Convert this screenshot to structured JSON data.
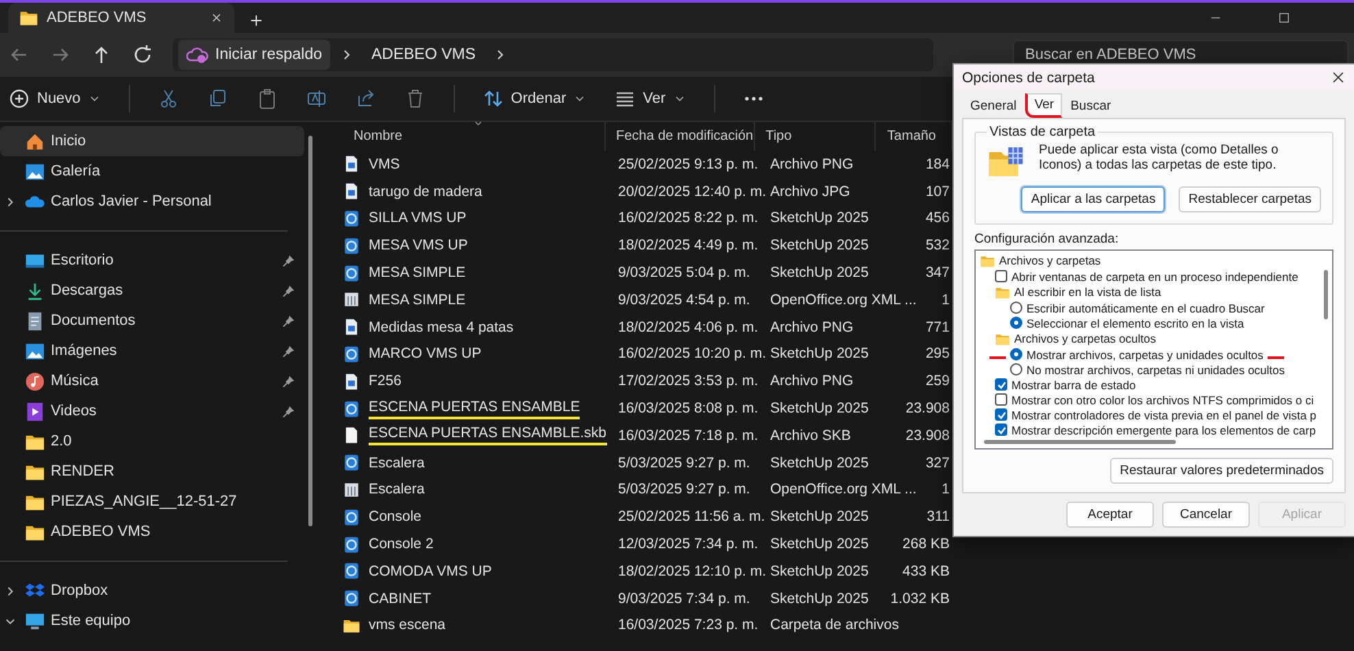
{
  "window": {
    "tab_title": "ADEBEO VMS"
  },
  "address": {
    "crumbs": [
      "Iniciar respaldo",
      "ADEBEO VMS"
    ]
  },
  "search": {
    "placeholder": "Buscar en ADEBEO VMS"
  },
  "toolbar": {
    "new_label": "Nuevo",
    "sort_label": "Ordenar",
    "view_label": "Ver"
  },
  "sidebar": {
    "sections": [
      {
        "items": [
          {
            "label": "Inicio",
            "kind": "home",
            "selected": true,
            "pinned": false
          },
          {
            "label": "Galería",
            "kind": "gallery",
            "selected": false,
            "pinned": false
          },
          {
            "label": "Carlos Javier - Personal",
            "kind": "cloud",
            "selected": false,
            "pinned": false,
            "expanded": false
          }
        ]
      },
      {
        "items": [
          {
            "label": "Escritorio",
            "kind": "desktop",
            "selected": false,
            "pinned": true
          },
          {
            "label": "Descargas",
            "kind": "download",
            "selected": false,
            "pinned": true
          },
          {
            "label": "Documentos",
            "kind": "document",
            "selected": false,
            "pinned": true
          },
          {
            "label": "Imágenes",
            "kind": "gallery",
            "selected": false,
            "pinned": true
          },
          {
            "label": "Música",
            "kind": "music",
            "selected": false,
            "pinned": true
          },
          {
            "label": "Videos",
            "kind": "video",
            "selected": false,
            "pinned": true
          },
          {
            "label": "2.0",
            "kind": "folder",
            "selected": false,
            "pinned": false
          },
          {
            "label": "RENDER",
            "kind": "folder",
            "selected": false,
            "pinned": false
          },
          {
            "label": "PIEZAS_ANGIE__12-51-27",
            "kind": "folder",
            "selected": false,
            "pinned": false
          },
          {
            "label": "ADEBEO VMS",
            "kind": "folder",
            "selected": false,
            "pinned": false
          }
        ]
      },
      {
        "items": [
          {
            "label": "Dropbox",
            "kind": "dropbox",
            "selected": false,
            "pinned": false,
            "expanded": false
          },
          {
            "label": "Este equipo",
            "kind": "computer",
            "selected": false,
            "pinned": false,
            "expanded": true
          }
        ]
      }
    ]
  },
  "file_list": {
    "columns": [
      "Nombre",
      "Fecha de modificación",
      "Tipo",
      "Tamaño"
    ],
    "rows": [
      {
        "name": "VMS",
        "date": "25/02/2025 9:13 p. m.",
        "type": "Archivo PNG",
        "size": "184",
        "kind": "image",
        "underlined": false
      },
      {
        "name": "tarugo de madera",
        "date": "20/02/2025 12:40 p. m.",
        "type": "Archivo JPG",
        "size": "107",
        "kind": "image",
        "underlined": false
      },
      {
        "name": "SILLA VMS UP",
        "date": "16/02/2025 8:22 p. m.",
        "type": "SketchUp 2025",
        "size": "456",
        "kind": "model",
        "underlined": false
      },
      {
        "name": "MESA VMS UP",
        "date": "18/02/2025 4:49 p. m.",
        "type": "SketchUp 2025",
        "size": "532",
        "kind": "model",
        "underlined": false
      },
      {
        "name": "MESA SIMPLE",
        "date": "9/03/2025 5:04 p. m.",
        "type": "SketchUp 2025",
        "size": "347",
        "kind": "model",
        "underlined": false
      },
      {
        "name": "MESA SIMPLE",
        "date": "9/03/2025 4:54 p. m.",
        "type": "OpenOffice.org XML ...",
        "size": "1",
        "kind": "sheet",
        "underlined": false
      },
      {
        "name": "Medidas mesa 4 patas",
        "date": "18/02/2025 4:06 p. m.",
        "type": "Archivo PNG",
        "size": "771",
        "kind": "image",
        "underlined": false
      },
      {
        "name": "MARCO VMS UP",
        "date": "16/02/2025 10:20 p. m.",
        "type": "SketchUp 2025",
        "size": "295",
        "kind": "model",
        "underlined": false
      },
      {
        "name": "F256",
        "date": "17/02/2025 3:53 p. m.",
        "type": "Archivo PNG",
        "size": "259",
        "kind": "image",
        "underlined": false
      },
      {
        "name": "ESCENA PUERTAS ENSAMBLE",
        "date": "16/03/2025 8:08 p. m.",
        "type": "SketchUp 2025",
        "size": "23.908",
        "kind": "model",
        "underlined": true
      },
      {
        "name": "ESCENA PUERTAS ENSAMBLE.skb",
        "date": "16/03/2025 7:18 p. m.",
        "type": "Archivo SKB",
        "size": "23.908",
        "kind": "blank",
        "underlined": true
      },
      {
        "name": "Escalera",
        "date": "5/03/2025 9:27 p. m.",
        "type": "SketchUp 2025",
        "size": "327",
        "kind": "model",
        "underlined": false
      },
      {
        "name": "Escalera",
        "date": "5/03/2025 9:27 p. m.",
        "type": "OpenOffice.org XML ...",
        "size": "1",
        "kind": "sheet",
        "underlined": false
      },
      {
        "name": "Console",
        "date": "25/02/2025 11:56 a. m.",
        "type": "SketchUp 2025",
        "size": "311",
        "kind": "model",
        "underlined": false
      },
      {
        "name": "Console 2",
        "date": "12/03/2025 7:34 p. m.",
        "type": "SketchUp 2025",
        "size": "268 KB",
        "kind": "model",
        "underlined": false
      },
      {
        "name": "COMODA VMS UP",
        "date": "18/02/2025 12:10 p. m.",
        "type": "SketchUp 2025",
        "size": "433 KB",
        "kind": "model",
        "underlined": false
      },
      {
        "name": "CABINET",
        "date": "9/03/2025 7:34 p. m.",
        "type": "SketchUp 2025",
        "size": "1.032 KB",
        "kind": "model",
        "underlined": false
      },
      {
        "name": "vms escena",
        "date": "16/03/2025 7:23 p. m.",
        "type": "Carpeta de archivos",
        "kind": "folder",
        "underlined": false
      }
    ]
  },
  "dialog": {
    "title": "Opciones de carpeta",
    "tabs": [
      {
        "label": "General",
        "selected": false,
        "annotated": false
      },
      {
        "label": "Ver",
        "selected": true,
        "annotated": true
      },
      {
        "label": "Buscar",
        "selected": false,
        "annotated": false
      }
    ],
    "folder_views": {
      "title": "Vistas de carpeta",
      "description": "Puede aplicar esta vista (como Detalles o Iconos) a todas las carpetas de este tipo.",
      "buttons": [
        {
          "label": "Aplicar a las carpetas",
          "focused": true
        },
        {
          "label": "Restablecer carpetas",
          "focused": false
        }
      ]
    },
    "advanced": {
      "label": "Configuración avanzada:",
      "items": [
        {
          "kind": "folder",
          "label": "Archivos y carpetas",
          "children": [
            {
              "kind": "checkbox",
              "label": "Abrir ventanas de carpeta  en un proceso independiente",
              "checked": false
            },
            {
              "kind": "folder",
              "label": "Al escribir en la vista de lista",
              "children": [
                {
                  "kind": "radio",
                  "label": "Escribir automáticamente en el cuadro Buscar",
                  "selected": false,
                  "annotated": false
                },
                {
                  "kind": "radio",
                  "label": "Seleccionar el elemento escrito en la vista",
                  "selected": true,
                  "annotated": false
                }
              ]
            },
            {
              "kind": "folder",
              "label": "Archivos y carpetas ocultos",
              "children": [
                {
                  "kind": "radio",
                  "label": "Mostrar archivos, carpetas y unidades ocultos",
                  "selected": true,
                  "annotated": true
                },
                {
                  "kind": "radio",
                  "label": "No mostrar archivos, carpetas ni unidades ocultos",
                  "selected": false,
                  "annotated": false
                }
              ]
            },
            {
              "kind": "checkbox",
              "label": "Mostrar barra de estado",
              "checked": true
            },
            {
              "kind": "checkbox",
              "label": "Mostrar con otro color los archivos NTFS comprimidos o ci",
              "checked": false
            },
            {
              "kind": "checkbox",
              "label": "Mostrar controladores de vista previa en el panel de vista p",
              "checked": true
            },
            {
              "kind": "checkbox",
              "label": "Mostrar descripción emergente para los elementos de carp",
              "checked": true
            }
          ]
        }
      ]
    },
    "restore_button": "Restaurar valores predeterminados",
    "buttons": [
      {
        "label": "Aceptar",
        "disabled": false
      },
      {
        "label": "Cancelar",
        "disabled": false
      },
      {
        "label": "Aplicar",
        "disabled": true
      }
    ]
  }
}
